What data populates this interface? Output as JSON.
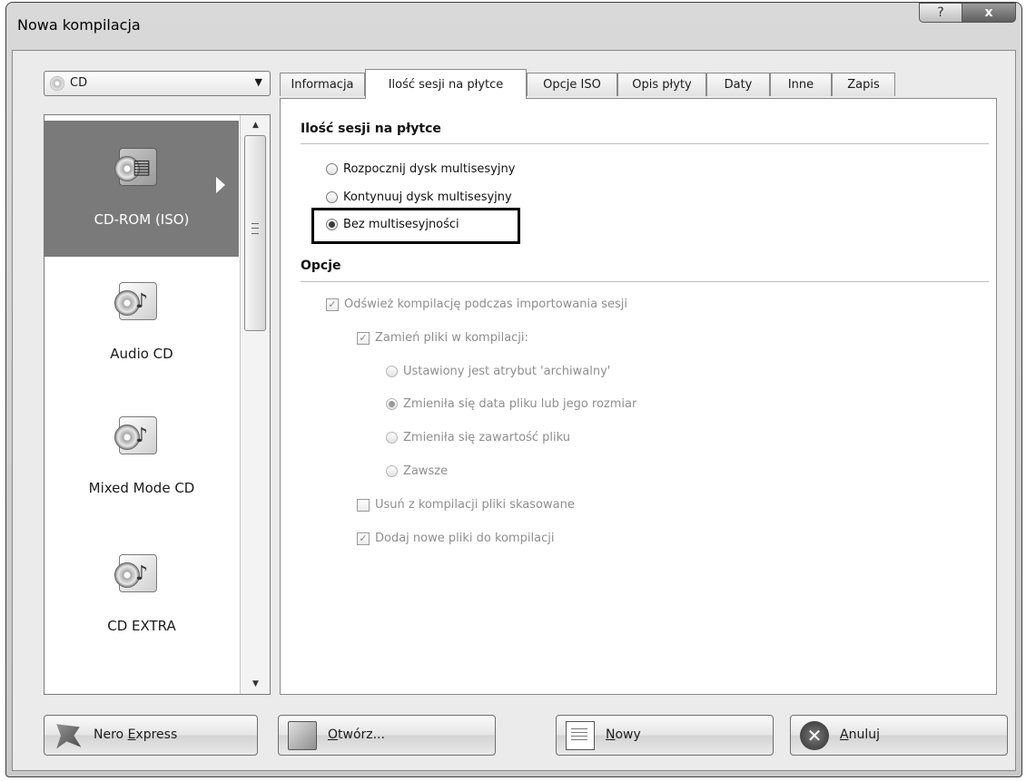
{
  "window": {
    "title": "Nowa kompilacja",
    "help_label": "?",
    "close_label": "x"
  },
  "media_select": {
    "value": "CD",
    "arrow": "▼"
  },
  "compilation_types": [
    {
      "label": "CD-ROM (ISO)",
      "icon": "data-disc-icon",
      "selected": true
    },
    {
      "label": "Audio CD",
      "icon": "music-note-icon",
      "selected": false
    },
    {
      "label": "Mixed Mode CD",
      "icon": "music-note-icon",
      "selected": false
    },
    {
      "label": "CD EXTRA",
      "icon": "music-note-icon",
      "selected": false
    }
  ],
  "scrollbar": {
    "up": "▲",
    "down": "▼"
  },
  "tabs": [
    {
      "label": "Informacja"
    },
    {
      "label": "Ilość sesji na płytce",
      "active": true
    },
    {
      "label": "Opcje ISO"
    },
    {
      "label": "Opis płyty"
    },
    {
      "label": "Daty"
    },
    {
      "label": "Inne"
    },
    {
      "label": "Zapis"
    }
  ],
  "sessions": {
    "heading": "Ilość sesji na płytce",
    "options": [
      {
        "label": "Rozpocznij dysk multisesyjny",
        "checked": false
      },
      {
        "label": "Kontynuuj dysk multisesyjny",
        "checked": false
      },
      {
        "label": "Bez multisesyjności",
        "checked": true
      }
    ]
  },
  "options": {
    "heading": "Opcje",
    "refresh": {
      "label": "Odśwież kompilację podczas importowania sesji",
      "checked": true,
      "enabled": false
    },
    "replace": {
      "label": "Zamień pliki w kompilacji:",
      "checked": true,
      "enabled": false
    },
    "replace_modes": [
      {
        "label": "Ustawiony jest atrybut 'archiwalny'",
        "checked": false
      },
      {
        "label": "Zmieniła się data pliku lub jego rozmiar",
        "checked": true
      },
      {
        "label": "Zmieniła się zawartość pliku",
        "checked": false
      },
      {
        "label": "Zawsze",
        "checked": false
      }
    ],
    "remove_deleted": {
      "label": "Usuń z kompilacji pliki skasowane",
      "checked": false,
      "enabled": false
    },
    "add_new": {
      "label": "Dodaj nowe pliki do kompilacji",
      "checked": true,
      "enabled": false
    }
  },
  "buttons": {
    "nero_express": {
      "pre": "Nero ",
      "key": "E",
      "post": "xpress"
    },
    "open": {
      "pre": "",
      "key": "O",
      "post": "twórz..."
    },
    "new": {
      "pre": "",
      "key": "N",
      "post": "owy"
    },
    "cancel": {
      "pre": "",
      "key": "A",
      "post": "nuluj"
    }
  },
  "check_mark": "✓",
  "cancel_glyph": "✕"
}
